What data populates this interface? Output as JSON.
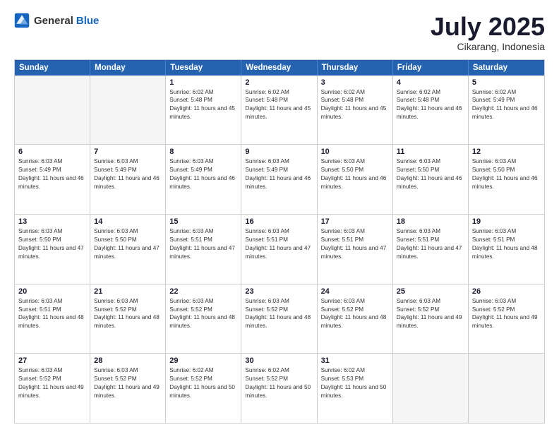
{
  "header": {
    "logo_general": "General",
    "logo_blue": "Blue",
    "month_title": "July 2025",
    "location": "Cikarang, Indonesia"
  },
  "days_of_week": [
    "Sunday",
    "Monday",
    "Tuesday",
    "Wednesday",
    "Thursday",
    "Friday",
    "Saturday"
  ],
  "weeks": [
    [
      {
        "day": "",
        "text": ""
      },
      {
        "day": "",
        "text": ""
      },
      {
        "day": "1",
        "text": "Sunrise: 6:02 AM\nSunset: 5:48 PM\nDaylight: 11 hours and 45 minutes."
      },
      {
        "day": "2",
        "text": "Sunrise: 6:02 AM\nSunset: 5:48 PM\nDaylight: 11 hours and 45 minutes."
      },
      {
        "day": "3",
        "text": "Sunrise: 6:02 AM\nSunset: 5:48 PM\nDaylight: 11 hours and 45 minutes."
      },
      {
        "day": "4",
        "text": "Sunrise: 6:02 AM\nSunset: 5:48 PM\nDaylight: 11 hours and 46 minutes."
      },
      {
        "day": "5",
        "text": "Sunrise: 6:02 AM\nSunset: 5:49 PM\nDaylight: 11 hours and 46 minutes."
      }
    ],
    [
      {
        "day": "6",
        "text": "Sunrise: 6:03 AM\nSunset: 5:49 PM\nDaylight: 11 hours and 46 minutes."
      },
      {
        "day": "7",
        "text": "Sunrise: 6:03 AM\nSunset: 5:49 PM\nDaylight: 11 hours and 46 minutes."
      },
      {
        "day": "8",
        "text": "Sunrise: 6:03 AM\nSunset: 5:49 PM\nDaylight: 11 hours and 46 minutes."
      },
      {
        "day": "9",
        "text": "Sunrise: 6:03 AM\nSunset: 5:49 PM\nDaylight: 11 hours and 46 minutes."
      },
      {
        "day": "10",
        "text": "Sunrise: 6:03 AM\nSunset: 5:50 PM\nDaylight: 11 hours and 46 minutes."
      },
      {
        "day": "11",
        "text": "Sunrise: 6:03 AM\nSunset: 5:50 PM\nDaylight: 11 hours and 46 minutes."
      },
      {
        "day": "12",
        "text": "Sunrise: 6:03 AM\nSunset: 5:50 PM\nDaylight: 11 hours and 46 minutes."
      }
    ],
    [
      {
        "day": "13",
        "text": "Sunrise: 6:03 AM\nSunset: 5:50 PM\nDaylight: 11 hours and 47 minutes."
      },
      {
        "day": "14",
        "text": "Sunrise: 6:03 AM\nSunset: 5:50 PM\nDaylight: 11 hours and 47 minutes."
      },
      {
        "day": "15",
        "text": "Sunrise: 6:03 AM\nSunset: 5:51 PM\nDaylight: 11 hours and 47 minutes."
      },
      {
        "day": "16",
        "text": "Sunrise: 6:03 AM\nSunset: 5:51 PM\nDaylight: 11 hours and 47 minutes."
      },
      {
        "day": "17",
        "text": "Sunrise: 6:03 AM\nSunset: 5:51 PM\nDaylight: 11 hours and 47 minutes."
      },
      {
        "day": "18",
        "text": "Sunrise: 6:03 AM\nSunset: 5:51 PM\nDaylight: 11 hours and 47 minutes."
      },
      {
        "day": "19",
        "text": "Sunrise: 6:03 AM\nSunset: 5:51 PM\nDaylight: 11 hours and 48 minutes."
      }
    ],
    [
      {
        "day": "20",
        "text": "Sunrise: 6:03 AM\nSunset: 5:51 PM\nDaylight: 11 hours and 48 minutes."
      },
      {
        "day": "21",
        "text": "Sunrise: 6:03 AM\nSunset: 5:52 PM\nDaylight: 11 hours and 48 minutes."
      },
      {
        "day": "22",
        "text": "Sunrise: 6:03 AM\nSunset: 5:52 PM\nDaylight: 11 hours and 48 minutes."
      },
      {
        "day": "23",
        "text": "Sunrise: 6:03 AM\nSunset: 5:52 PM\nDaylight: 11 hours and 48 minutes."
      },
      {
        "day": "24",
        "text": "Sunrise: 6:03 AM\nSunset: 5:52 PM\nDaylight: 11 hours and 48 minutes."
      },
      {
        "day": "25",
        "text": "Sunrise: 6:03 AM\nSunset: 5:52 PM\nDaylight: 11 hours and 49 minutes."
      },
      {
        "day": "26",
        "text": "Sunrise: 6:03 AM\nSunset: 5:52 PM\nDaylight: 11 hours and 49 minutes."
      }
    ],
    [
      {
        "day": "27",
        "text": "Sunrise: 6:03 AM\nSunset: 5:52 PM\nDaylight: 11 hours and 49 minutes."
      },
      {
        "day": "28",
        "text": "Sunrise: 6:03 AM\nSunset: 5:52 PM\nDaylight: 11 hours and 49 minutes."
      },
      {
        "day": "29",
        "text": "Sunrise: 6:02 AM\nSunset: 5:52 PM\nDaylight: 11 hours and 50 minutes."
      },
      {
        "day": "30",
        "text": "Sunrise: 6:02 AM\nSunset: 5:52 PM\nDaylight: 11 hours and 50 minutes."
      },
      {
        "day": "31",
        "text": "Sunrise: 6:02 AM\nSunset: 5:53 PM\nDaylight: 11 hours and 50 minutes."
      },
      {
        "day": "",
        "text": ""
      },
      {
        "day": "",
        "text": ""
      }
    ]
  ]
}
